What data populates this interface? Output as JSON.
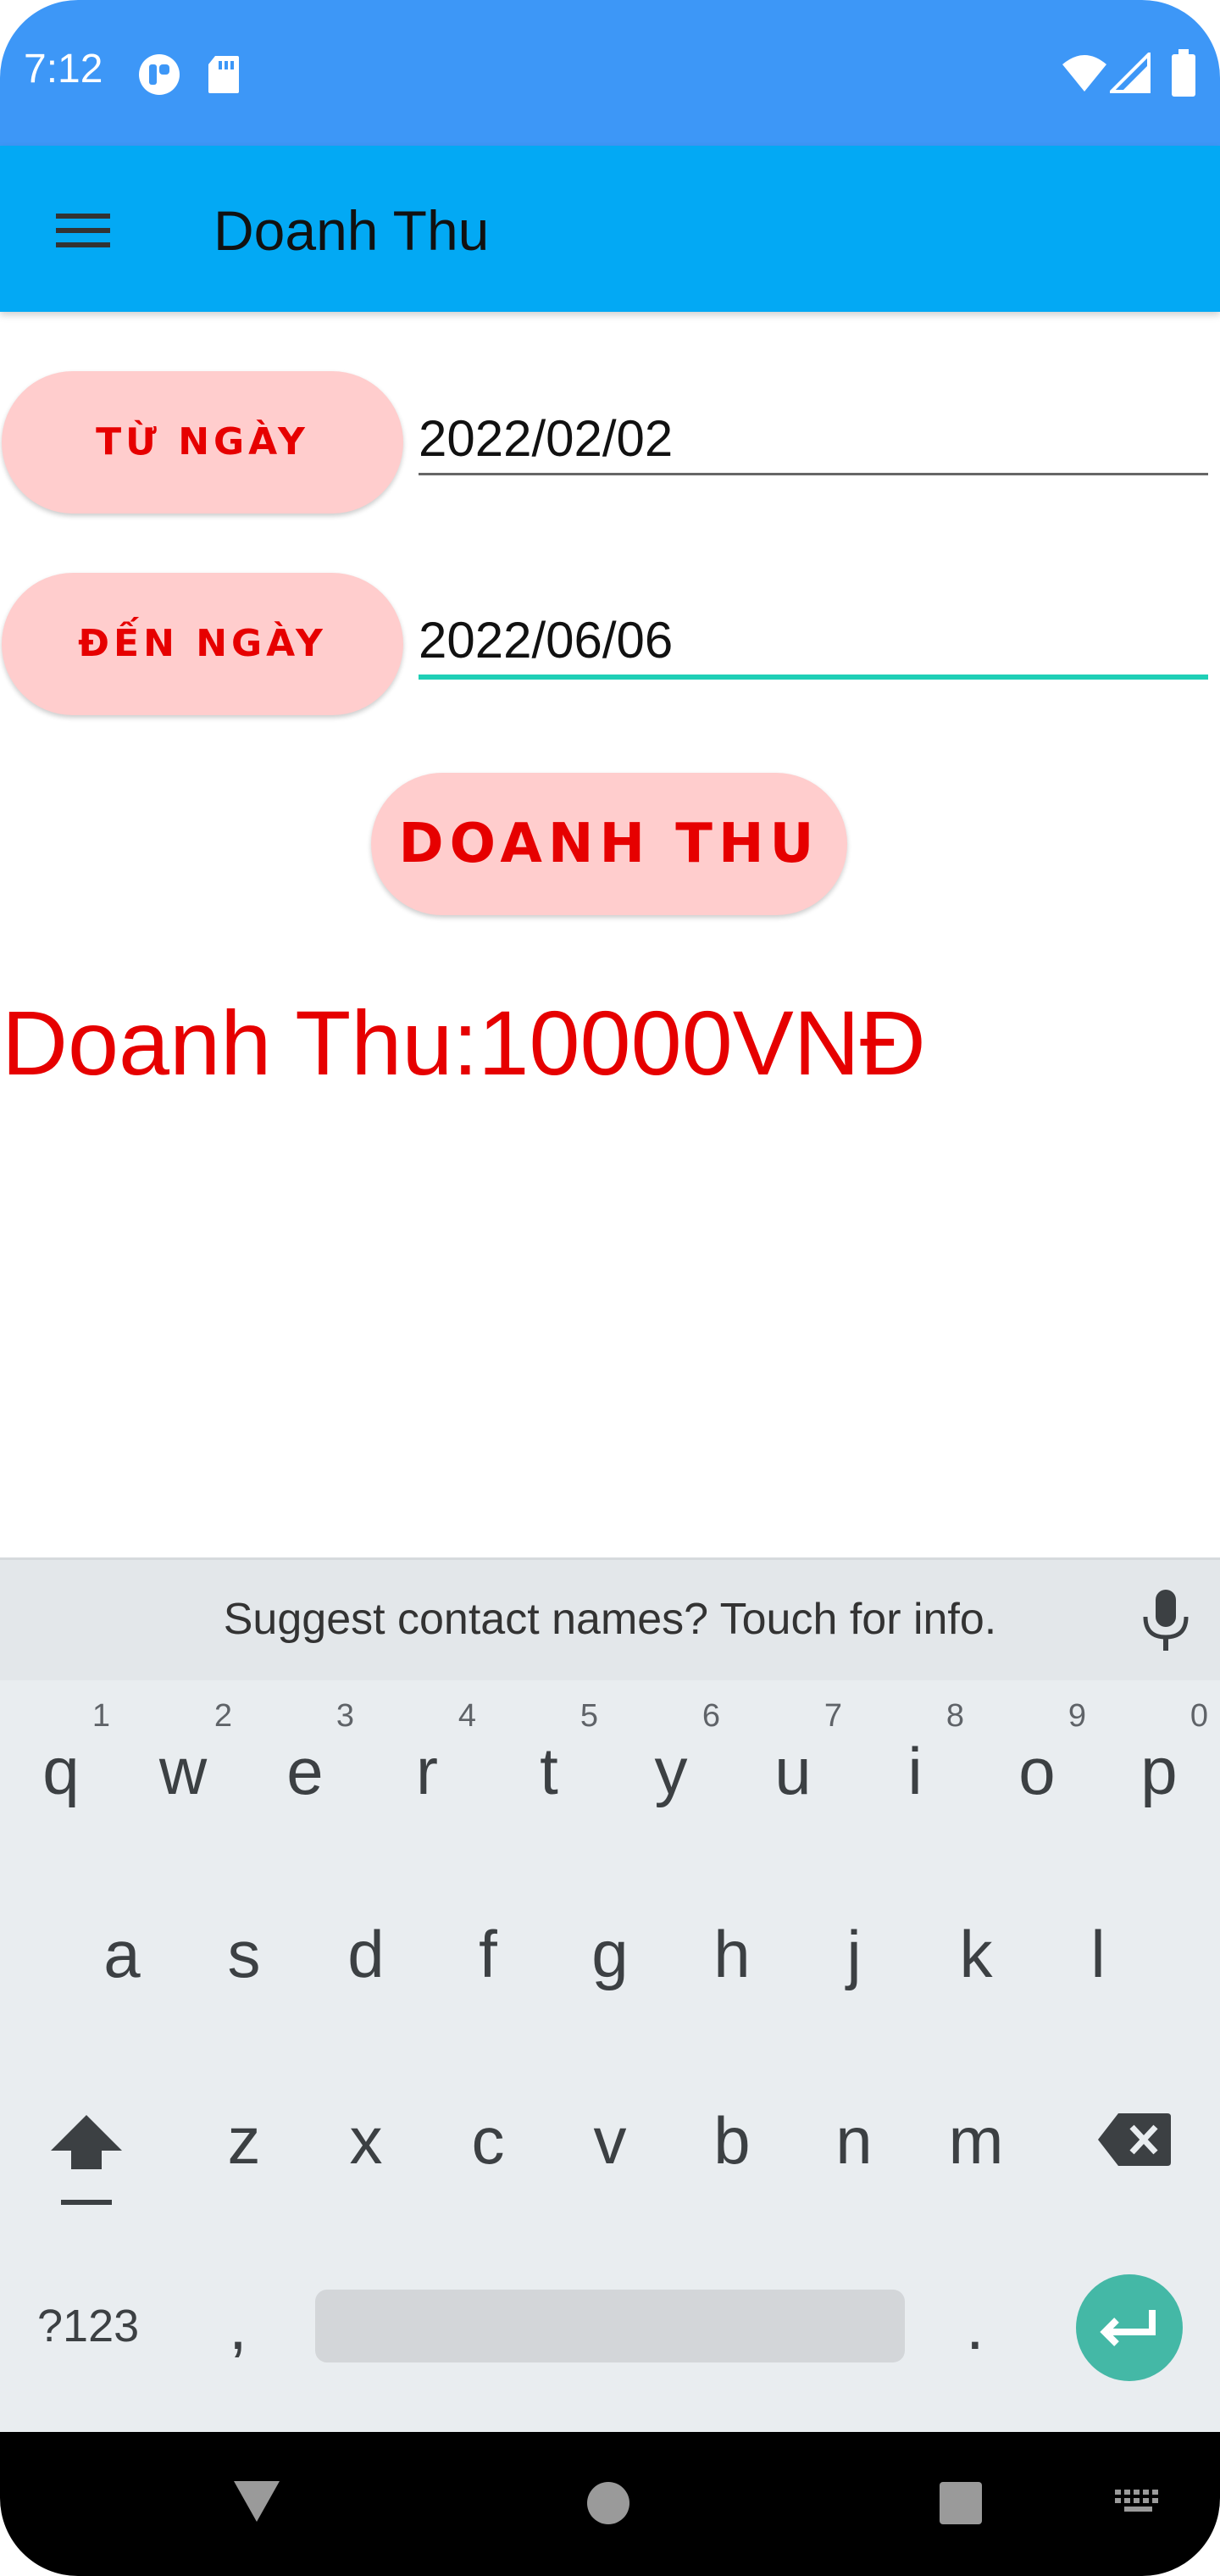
{
  "status": {
    "time": "7:12"
  },
  "appbar": {
    "title": "Doanh Thu"
  },
  "form": {
    "from_label": "TỪ NGÀY",
    "from_value": "2022/02/02",
    "to_label": "ĐẾN NGÀY",
    "to_value": "2022/06/06",
    "submit_label": "DOANH THU",
    "result": "Doanh Thu:10000VNĐ"
  },
  "keyboard": {
    "suggestion": "Suggest contact names? Touch for info.",
    "row1": [
      {
        "ch": "q",
        "hint": "1"
      },
      {
        "ch": "w",
        "hint": "2"
      },
      {
        "ch": "e",
        "hint": "3"
      },
      {
        "ch": "r",
        "hint": "4"
      },
      {
        "ch": "t",
        "hint": "5"
      },
      {
        "ch": "y",
        "hint": "6"
      },
      {
        "ch": "u",
        "hint": "7"
      },
      {
        "ch": "i",
        "hint": "8"
      },
      {
        "ch": "o",
        "hint": "9"
      },
      {
        "ch": "p",
        "hint": "0"
      }
    ],
    "row2": [
      "a",
      "s",
      "d",
      "f",
      "g",
      "h",
      "j",
      "k",
      "l"
    ],
    "row3": [
      "z",
      "x",
      "c",
      "v",
      "b",
      "n",
      "m"
    ],
    "symbols_label": "?123",
    "comma": ",",
    "period": "."
  },
  "colors": {
    "status_bar": "#3d97f7",
    "app_bar": "#03a9f4",
    "pill": "#ffcdcd",
    "accent_text": "#e60000",
    "underline_active": "#1fcfb6",
    "enter_key": "#44b8a6"
  },
  "icons": [
    "menu-icon",
    "wifi-icon",
    "signal-icon",
    "battery-icon",
    "mic-icon",
    "shift-icon",
    "backspace-icon",
    "enter-icon",
    "back-icon",
    "home-icon",
    "recents-icon",
    "keyboard-icon"
  ]
}
